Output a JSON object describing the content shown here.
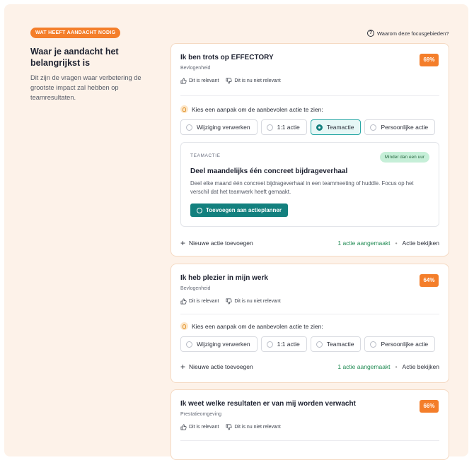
{
  "header": {
    "badge": "WAT HEEFT AANDACHT NODIG",
    "why_link": "Waarom deze focusgebieden?",
    "title": "Waar je aandacht het belangrijkst is",
    "intro": "Dit zijn de vragen waar verbetering de grootste impact zal hebben op teamresultaten."
  },
  "labels": {
    "relevant": "Dit is relevant",
    "not_relevant": "Dit is nu niet relevant",
    "prompt": "Kies een aanpak om de aanbevolen actie te zien:",
    "new_action": "Nieuwe actie toevoegen",
    "created": "1 actie aangemaakt",
    "view_action": "Actie bekijken",
    "dot": "•"
  },
  "options": [
    "Wijziging verwerken",
    "1:1 actie",
    "Teamactie",
    "Persoonlijke actie"
  ],
  "cards": [
    {
      "title": "Ik ben trots op EFFECTORY",
      "category": "Bevlogenheid",
      "score": "69%",
      "selected_option": "Teamactie",
      "action": {
        "type": "TEAMACTIE",
        "time": "Minder dan een uur",
        "title": "Deel maandelijks één concreet bijdrageverhaal",
        "description": "Deel elke maand één concreet bijdrageverhaal in een teammeeting of huddle. Focus op het verschil dat het teamwerk heeft gemaakt.",
        "button": "Toevoegen aan actieplanner"
      }
    },
    {
      "title": "Ik heb plezier in mijn werk",
      "category": "Bevlogenheid",
      "score": "64%"
    },
    {
      "title": "Ik weet welke resultaten er van mij worden verwacht",
      "category": "Prestatieomgeving",
      "score": "66%"
    }
  ],
  "colors": {
    "accent_orange": "#f47e2a",
    "teal": "#13807e",
    "panel_bg": "#fdf2e9",
    "green_text": "#1f8a52"
  }
}
